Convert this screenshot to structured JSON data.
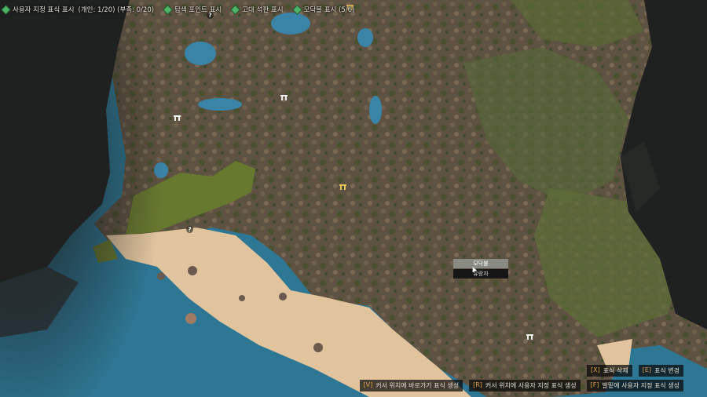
{
  "filters": [
    {
      "label": "사용자 지정 표식 표시",
      "detail": "(개인: 1/20) (부족: 0/20)",
      "icon": "green-diamond-icon"
    },
    {
      "label": "탐색 포인트 표시",
      "detail": "",
      "icon": "green-diamond-icon"
    },
    {
      "label": "고대 석판 표시",
      "detail": "",
      "icon": "green-diamond-icon"
    },
    {
      "label": "모닥불 표시 (5/6)",
      "detail": "",
      "icon": "green-diamond-icon"
    }
  ],
  "tooltip": {
    "top": "모닥불",
    "bottom": "유랑자"
  },
  "hints": {
    "delete": {
      "key": "[X]",
      "text": "표식 삭제"
    },
    "change": {
      "key": "[E]",
      "text": "표식 변경"
    },
    "shortcut": {
      "key": "[V]",
      "text": "커서 위치에 바로가기 표식 생성"
    },
    "custom_cursor": {
      "key": "[R]",
      "text": "커서 위치에 사용자 지정 표식 생성"
    },
    "custom_feet": {
      "key": "[F]",
      "text": "발밑에 사용자 지정 표식 생성"
    }
  },
  "colors": {
    "terrain": "#5e5242",
    "grass": "#5c6a34",
    "sand": "#e1c49e",
    "water": "#2e7794",
    "fog": "#1f2120",
    "filter_icon": "#4fb36a",
    "key": "#e0a14a"
  }
}
